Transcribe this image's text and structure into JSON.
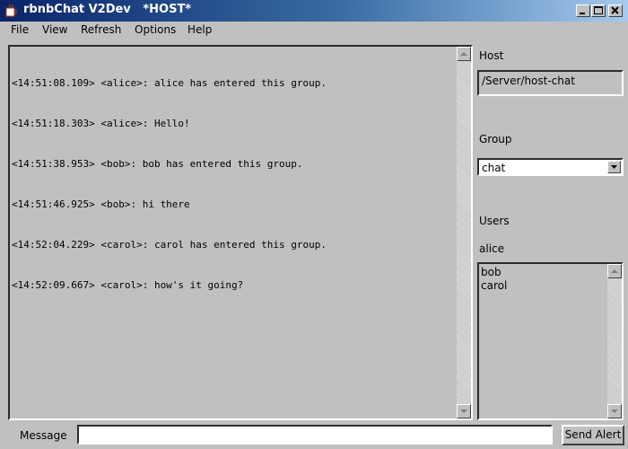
{
  "window": {
    "title": "rbnbChat V2Dev   *HOST*"
  },
  "menu": [
    "File",
    "View",
    "Refresh",
    "Options",
    "Help"
  ],
  "chat": {
    "lines": [
      "<14:51:08.109> <alice>: alice has entered this group.",
      "<14:51:18.303> <alice>: Hello!",
      "<14:51:38.953> <bob>: bob has entered this group.",
      "<14:51:46.925> <bob>: hi there",
      "<14:52:04.229> <carol>: carol has entered this group.",
      "<14:52:09.667> <carol>: how's it going?"
    ]
  },
  "host": {
    "label": "Host",
    "value": "/Server/host-chat"
  },
  "group": {
    "label": "Group",
    "selected": "chat"
  },
  "users": {
    "label": "Users",
    "current": "alice",
    "list": [
      "bob",
      "carol"
    ]
  },
  "message": {
    "label": "Message",
    "value": ""
  },
  "send": {
    "label": "Send Alert"
  },
  "icons": {
    "app": "coffee-cup-icon",
    "minimize": "minimize-icon",
    "maximize": "maximize-icon",
    "close": "close-icon",
    "scroll_up": "arrow-up-icon",
    "scroll_down": "arrow-down-icon",
    "dropdown": "chevron-down-icon"
  }
}
